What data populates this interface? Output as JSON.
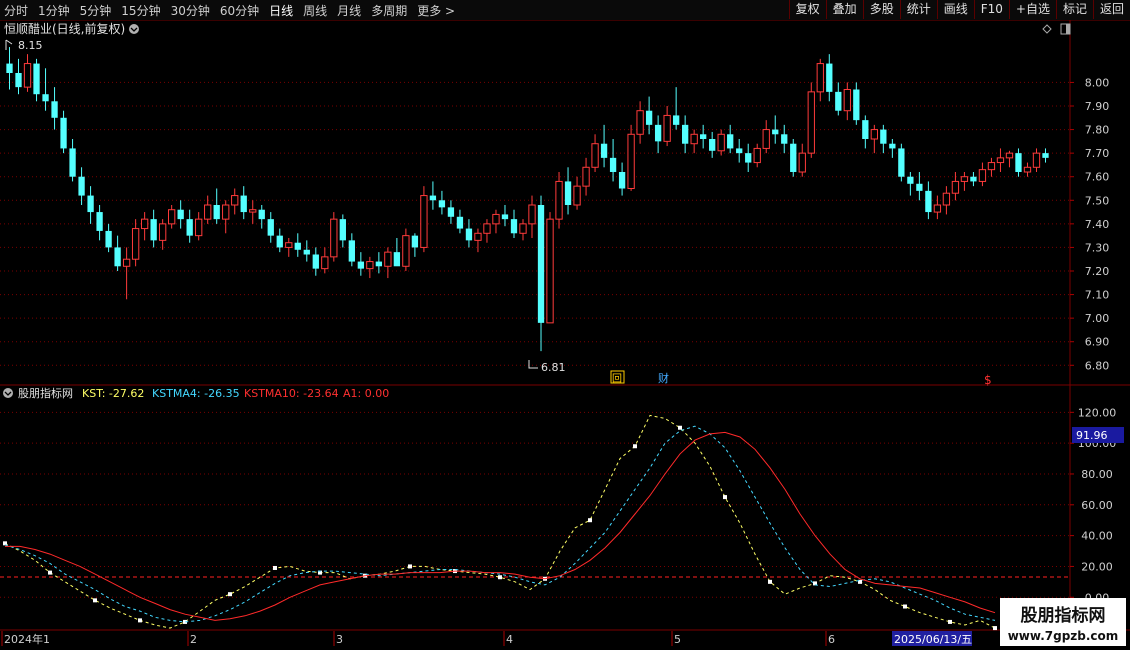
{
  "toolbar": {
    "periods": [
      "分时",
      "1分钟",
      "5分钟",
      "15分钟",
      "30分钟",
      "60分钟",
      "日线",
      "周线",
      "月线",
      "多周期",
      "更多 >"
    ],
    "active_period": "日线",
    "actions": [
      "复权",
      "叠加",
      "多股",
      "统计",
      "画线",
      "F10",
      "+自选",
      "标记",
      "返回"
    ]
  },
  "price_panel": {
    "title": "恒顺醋业(日线,前复权)",
    "high_label": "8.15",
    "low_label": "6.81",
    "axis_ticks": [
      "8.00",
      "7.90",
      "7.80",
      "7.70",
      "7.60",
      "7.50",
      "7.40",
      "7.30",
      "7.20",
      "7.10",
      "7.00",
      "6.90",
      "6.80"
    ],
    "markers": [
      {
        "text": "回",
        "color": "#ffcc00"
      },
      {
        "text": "财",
        "color": "#44aaff"
      },
      {
        "text": "$",
        "color": "#ff3030"
      }
    ]
  },
  "indicator_panel": {
    "name": "股朋指标网",
    "kst_label": "KST: -27.62",
    "kstma4_label": "KSTMA4: -26.35",
    "kstma10_label": "KSTMA10: -23.64",
    "a1_label": "A1: 0.00",
    "axis_ticks": [
      "120.00",
      "100.00",
      "80.00",
      "60.00",
      "40.00",
      "20.00",
      "0.00"
    ],
    "current_value": "91.96"
  },
  "date_axis": {
    "labels": [
      "2024年1",
      "2",
      "3",
      "4",
      "5",
      "6"
    ],
    "highlight": "2025/06/13/五"
  },
  "watermark": {
    "title": "股朋指标网",
    "url": "www.7gpzb.com"
  },
  "colors": {
    "up": "#ff3b3b",
    "down": "#54ffff",
    "kst": "#ffff66",
    "kstma4": "#44d8ff",
    "kstma10": "#ff2a2a",
    "grid": "#7a0000"
  },
  "chart_data": [
    {
      "type": "candlestick",
      "y_range": [
        6.78,
        8.18
      ],
      "candles_ohlc": [
        [
          8.08,
          8.15,
          7.97,
          8.04
        ],
        [
          8.04,
          8.1,
          7.95,
          7.98
        ],
        [
          7.98,
          8.12,
          7.96,
          8.08
        ],
        [
          8.08,
          8.1,
          7.92,
          7.95
        ],
        [
          7.95,
          8.06,
          7.88,
          7.92
        ],
        [
          7.92,
          7.98,
          7.8,
          7.85
        ],
        [
          7.85,
          7.88,
          7.7,
          7.72
        ],
        [
          7.72,
          7.76,
          7.58,
          7.6
        ],
        [
          7.6,
          7.64,
          7.48,
          7.52
        ],
        [
          7.52,
          7.56,
          7.4,
          7.45
        ],
        [
          7.45,
          7.48,
          7.33,
          7.37
        ],
        [
          7.37,
          7.4,
          7.28,
          7.3
        ],
        [
          7.3,
          7.35,
          7.2,
          7.22
        ],
        [
          7.22,
          7.3,
          7.08,
          7.25
        ],
        [
          7.25,
          7.42,
          7.22,
          7.38
        ],
        [
          7.38,
          7.45,
          7.33,
          7.42
        ],
        [
          7.42,
          7.46,
          7.3,
          7.33
        ],
        [
          7.33,
          7.42,
          7.29,
          7.4
        ],
        [
          7.4,
          7.48,
          7.38,
          7.46
        ],
        [
          7.46,
          7.5,
          7.38,
          7.42
        ],
        [
          7.42,
          7.46,
          7.32,
          7.35
        ],
        [
          7.35,
          7.45,
          7.33,
          7.42
        ],
        [
          7.42,
          7.52,
          7.4,
          7.48
        ],
        [
          7.48,
          7.55,
          7.4,
          7.42
        ],
        [
          7.42,
          7.5,
          7.36,
          7.48
        ],
        [
          7.48,
          7.55,
          7.44,
          7.52
        ],
        [
          7.52,
          7.56,
          7.42,
          7.45
        ],
        [
          7.45,
          7.5,
          7.4,
          7.46
        ],
        [
          7.46,
          7.48,
          7.38,
          7.42
        ],
        [
          7.42,
          7.45,
          7.32,
          7.35
        ],
        [
          7.35,
          7.38,
          7.28,
          7.3
        ],
        [
          7.3,
          7.34,
          7.26,
          7.32
        ],
        [
          7.32,
          7.36,
          7.26,
          7.29
        ],
        [
          7.29,
          7.33,
          7.24,
          7.27
        ],
        [
          7.27,
          7.3,
          7.18,
          7.21
        ],
        [
          7.21,
          7.3,
          7.19,
          7.26
        ],
        [
          7.26,
          7.45,
          7.24,
          7.42
        ],
        [
          7.42,
          7.44,
          7.3,
          7.33
        ],
        [
          7.33,
          7.36,
          7.22,
          7.24
        ],
        [
          7.24,
          7.28,
          7.18,
          7.21
        ],
        [
          7.21,
          7.26,
          7.17,
          7.24
        ],
        [
          7.24,
          7.28,
          7.19,
          7.22
        ],
        [
          7.22,
          7.3,
          7.17,
          7.28
        ],
        [
          7.28,
          7.34,
          7.24,
          7.22
        ],
        [
          7.22,
          7.38,
          7.2,
          7.35
        ],
        [
          7.35,
          7.36,
          7.26,
          7.3
        ],
        [
          7.3,
          7.56,
          7.28,
          7.52
        ],
        [
          7.52,
          7.58,
          7.46,
          7.5
        ],
        [
          7.5,
          7.54,
          7.44,
          7.47
        ],
        [
          7.47,
          7.5,
          7.4,
          7.43
        ],
        [
          7.43,
          7.46,
          7.36,
          7.38
        ],
        [
          7.38,
          7.42,
          7.3,
          7.33
        ],
        [
          7.33,
          7.38,
          7.28,
          7.36
        ],
        [
          7.36,
          7.42,
          7.32,
          7.4
        ],
        [
          7.4,
          7.46,
          7.36,
          7.44
        ],
        [
          7.44,
          7.48,
          7.39,
          7.42
        ],
        [
          7.42,
          7.46,
          7.34,
          7.36
        ],
        [
          7.36,
          7.42,
          7.33,
          7.4
        ],
        [
          7.4,
          7.52,
          7.34,
          7.48
        ],
        [
          7.48,
          7.52,
          6.86,
          6.98
        ],
        [
          6.98,
          7.45,
          6.98,
          7.42
        ],
        [
          7.42,
          7.62,
          7.38,
          7.58
        ],
        [
          7.58,
          7.64,
          7.44,
          7.48
        ],
        [
          7.48,
          7.6,
          7.46,
          7.56
        ],
        [
          7.56,
          7.68,
          7.52,
          7.64
        ],
        [
          7.64,
          7.78,
          7.62,
          7.74
        ],
        [
          7.74,
          7.82,
          7.64,
          7.68
        ],
        [
          7.68,
          7.76,
          7.58,
          7.62
        ],
        [
          7.62,
          7.66,
          7.52,
          7.55
        ],
        [
          7.55,
          7.82,
          7.54,
          7.78
        ],
        [
          7.78,
          7.92,
          7.74,
          7.88
        ],
        [
          7.88,
          7.94,
          7.78,
          7.82
        ],
        [
          7.82,
          7.86,
          7.7,
          7.75
        ],
        [
          7.75,
          7.9,
          7.73,
          7.86
        ],
        [
          7.86,
          7.98,
          7.8,
          7.82
        ],
        [
          7.82,
          7.86,
          7.7,
          7.74
        ],
        [
          7.74,
          7.8,
          7.7,
          7.78
        ],
        [
          7.78,
          7.82,
          7.72,
          7.76
        ],
        [
          7.76,
          7.79,
          7.68,
          7.71
        ],
        [
          7.71,
          7.8,
          7.69,
          7.78
        ],
        [
          7.78,
          7.82,
          7.7,
          7.72
        ],
        [
          7.72,
          7.76,
          7.66,
          7.7
        ],
        [
          7.7,
          7.74,
          7.62,
          7.66
        ],
        [
          7.66,
          7.74,
          7.64,
          7.72
        ],
        [
          7.72,
          7.84,
          7.7,
          7.8
        ],
        [
          7.8,
          7.86,
          7.74,
          7.78
        ],
        [
          7.78,
          7.82,
          7.7,
          7.74
        ],
        [
          7.74,
          7.76,
          7.6,
          7.62
        ],
        [
          7.62,
          7.74,
          7.6,
          7.7
        ],
        [
          7.7,
          8.0,
          7.68,
          7.96
        ],
        [
          7.96,
          8.1,
          7.92,
          8.08
        ],
        [
          8.08,
          8.12,
          7.92,
          7.96
        ],
        [
          7.96,
          8.0,
          7.86,
          7.88
        ],
        [
          7.88,
          8.0,
          7.84,
          7.97
        ],
        [
          7.97,
          8.0,
          7.82,
          7.84
        ],
        [
          7.84,
          7.86,
          7.72,
          7.76
        ],
        [
          7.76,
          7.82,
          7.7,
          7.8
        ],
        [
          7.8,
          7.82,
          7.7,
          7.74
        ],
        [
          7.74,
          7.76,
          7.68,
          7.72
        ],
        [
          7.72,
          7.74,
          7.58,
          7.6
        ],
        [
          7.6,
          7.62,
          7.52,
          7.57
        ],
        [
          7.57,
          7.62,
          7.5,
          7.54
        ],
        [
          7.54,
          7.58,
          7.42,
          7.45
        ],
        [
          7.45,
          7.52,
          7.42,
          7.48
        ],
        [
          7.48,
          7.56,
          7.44,
          7.53
        ],
        [
          7.53,
          7.62,
          7.5,
          7.58
        ],
        [
          7.58,
          7.62,
          7.54,
          7.6
        ],
        [
          7.6,
          7.62,
          7.56,
          7.58
        ],
        [
          7.58,
          7.66,
          7.56,
          7.63
        ],
        [
          7.63,
          7.68,
          7.6,
          7.66
        ],
        [
          7.66,
          7.72,
          7.62,
          7.68
        ],
        [
          7.68,
          7.71,
          7.64,
          7.7
        ],
        [
          7.7,
          7.72,
          7.6,
          7.62
        ],
        [
          7.62,
          7.66,
          7.6,
          7.64
        ],
        [
          7.64,
          7.72,
          7.62,
          7.7
        ],
        [
          7.7,
          7.72,
          7.66,
          7.68
        ]
      ]
    },
    {
      "type": "line",
      "y_range": [
        -18,
        128
      ],
      "series": [
        {
          "name": "KST",
          "color": "#ffff66",
          "dash": "3,3",
          "values": [
            35,
            30,
            24,
            16,
            10,
            4,
            -2,
            -7,
            -11,
            -15,
            -18,
            -20,
            -16,
            -9,
            -2,
            2,
            7,
            13,
            19,
            20,
            17,
            16,
            16,
            12,
            14,
            15,
            17,
            20,
            20,
            18,
            17,
            16,
            15,
            13,
            10,
            5,
            12,
            30,
            45,
            50,
            70,
            90,
            98,
            118,
            116,
            110,
            100,
            85,
            65,
            48,
            28,
            10,
            2,
            6,
            9,
            14,
            13,
            10,
            5,
            -2,
            -6,
            -10,
            -13,
            -16,
            -18,
            -15,
            -20
          ]
        },
        {
          "name": "KSTMA4",
          "color": "#44d8ff",
          "dash": "3,3",
          "values": [
            34,
            31,
            27,
            22,
            15,
            10,
            5,
            -1,
            -6,
            -9,
            -13,
            -15,
            -16,
            -15,
            -12,
            -8,
            -3,
            3,
            9,
            14,
            16,
            17,
            17,
            16,
            15,
            14,
            15,
            16,
            17,
            18,
            18,
            17,
            16,
            15,
            13,
            10,
            8,
            13,
            22,
            32,
            42,
            56,
            70,
            84,
            100,
            108,
            111,
            106,
            97,
            82,
            65,
            48,
            32,
            18,
            8,
            7,
            9,
            11,
            12,
            10,
            6,
            2,
            -2,
            -7,
            -11,
            -13,
            -15
          ]
        },
        {
          "name": "KSTMA10",
          "color": "#ff2a2a",
          "dash": "",
          "values": [
            33,
            33,
            31,
            28,
            24,
            20,
            15,
            10,
            5,
            0,
            -4,
            -8,
            -11,
            -13,
            -15,
            -14,
            -12,
            -9,
            -5,
            0,
            4,
            8,
            10,
            12,
            14,
            15,
            15,
            16,
            16,
            16,
            17,
            17,
            16,
            16,
            15,
            13,
            12,
            14,
            18,
            24,
            32,
            42,
            54,
            66,
            80,
            93,
            102,
            106,
            107,
            104,
            96,
            84,
            70,
            54,
            40,
            28,
            18,
            12,
            9,
            8,
            7,
            6,
            3,
            0,
            -3,
            -7,
            -10
          ]
        }
      ]
    }
  ]
}
